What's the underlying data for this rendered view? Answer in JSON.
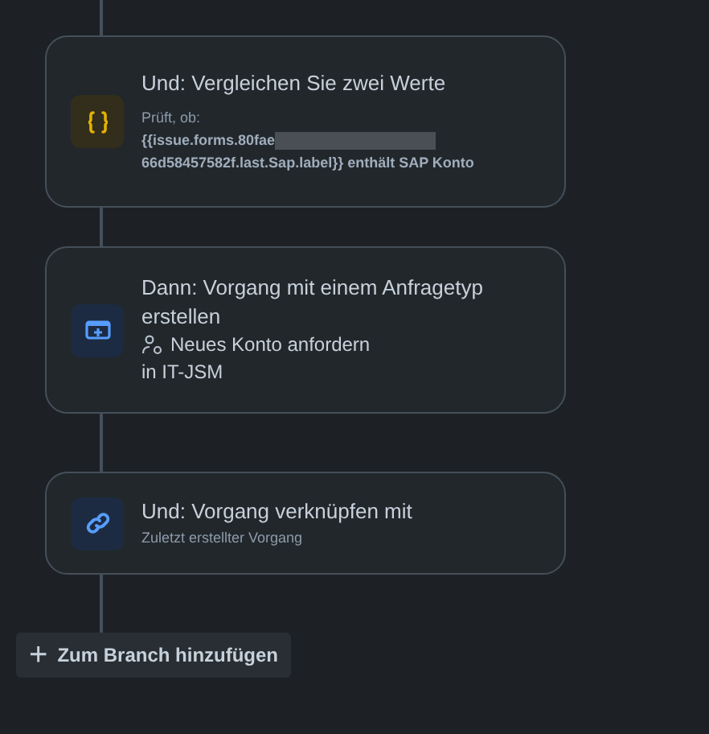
{
  "steps": [
    {
      "kind": "condition",
      "title": "Und: Vergleichen Sie zwei Werte",
      "details": [
        {
          "kind": "small",
          "text": "Prüft, ob:"
        },
        {
          "kind": "bold",
          "text": "{{issue.forms.80fae",
          "redacted": true
        },
        {
          "kind": "bold",
          "text": "66d58457582f.last.Sap.label}} enthält SAP Konto"
        }
      ]
    },
    {
      "kind": "create",
      "title": "Dann: Vorgang mit einem Anfragetyp erstellen",
      "details": [
        {
          "kind": "requesttype",
          "text": "Neues Konto anfordern"
        },
        {
          "kind": "plain",
          "text": "in IT-JSM"
        }
      ]
    },
    {
      "kind": "link",
      "title": "Und: Vorgang verknüpfen mit",
      "details": [
        {
          "kind": "small",
          "text": "Zuletzt erstellter Vorgang"
        }
      ]
    }
  ],
  "add_button": {
    "icon": "+",
    "label": "Zum Branch hinzufügen"
  }
}
